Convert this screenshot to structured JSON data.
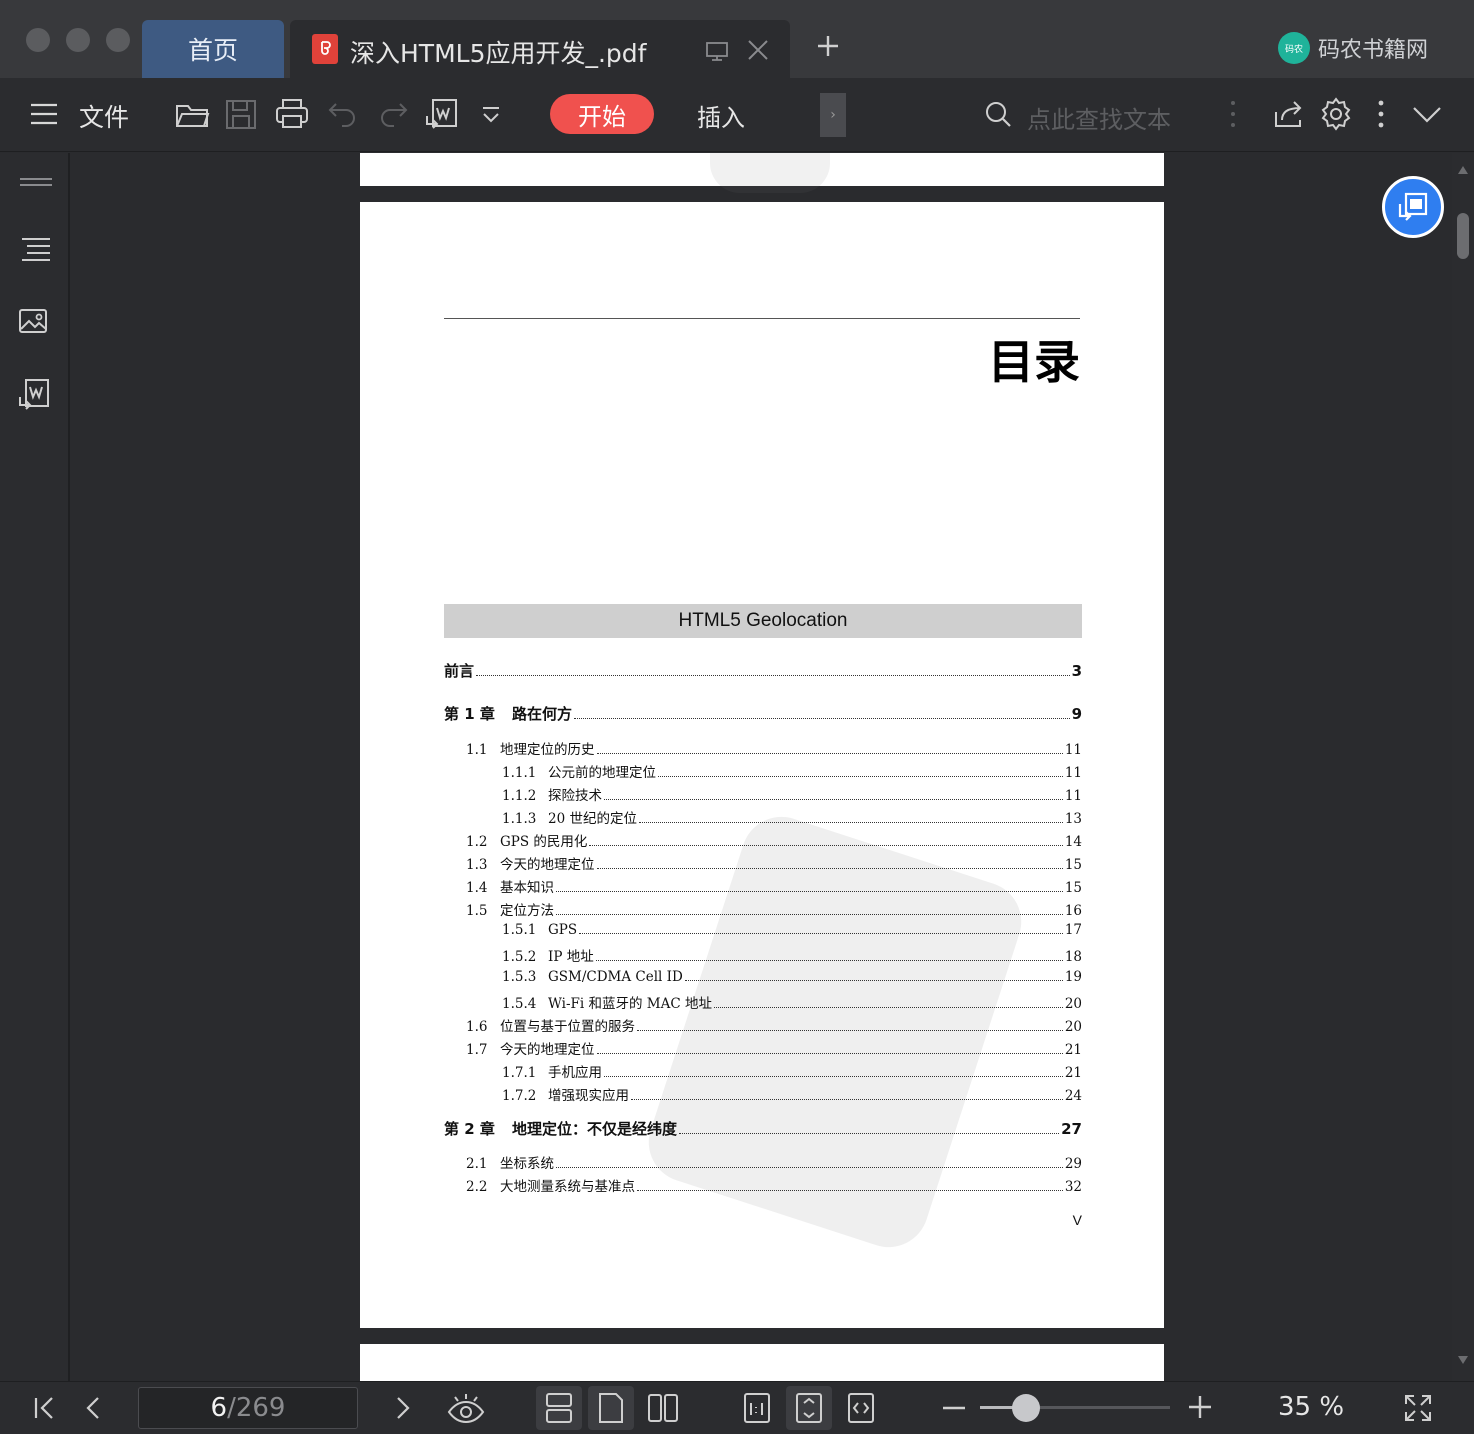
{
  "tabs": {
    "home_label": "首页",
    "doc_title": "深入HTML5应用开发_.pdf"
  },
  "brand": {
    "logo_text": "码农",
    "name": "码农书籍网"
  },
  "toolbar": {
    "file_label": "文件",
    "start_label": "开始",
    "insert_label": "插入",
    "search_placeholder": "点此查找文本"
  },
  "document": {
    "toc_title": "目录",
    "banner": "HTML5 Geolocation",
    "entries": [
      {
        "level": 0,
        "num": "",
        "text": "前言",
        "page": "3"
      },
      {
        "level": 0,
        "num": "第 1 章",
        "text": "路在何方",
        "page": "9"
      },
      {
        "level": 1,
        "num": "1.1",
        "text": "地理定位的历史",
        "page": "11"
      },
      {
        "level": 2,
        "num": "1.1.1",
        "text": "公元前的地理定位",
        "page": "11"
      },
      {
        "level": 2,
        "num": "1.1.2",
        "text": "探险技术",
        "page": "11"
      },
      {
        "level": 2,
        "num": "1.1.3",
        "text": "20 世纪的定位",
        "page": "13"
      },
      {
        "level": 1,
        "num": "1.2",
        "text": "GPS 的民用化",
        "page": "14"
      },
      {
        "level": 1,
        "num": "1.3",
        "text": "今天的地理定位",
        "page": "15"
      },
      {
        "level": 1,
        "num": "1.4",
        "text": "基本知识",
        "page": "15"
      },
      {
        "level": 1,
        "num": "1.5",
        "text": "定位方法",
        "page": "16"
      },
      {
        "level": 2,
        "num": "1.5.1",
        "text": "GPS",
        "page": "17"
      },
      {
        "level": 2,
        "num": "1.5.2",
        "text": "IP 地址",
        "page": "18"
      },
      {
        "level": 2,
        "num": "1.5.3",
        "text": "GSM/CDMA Cell ID",
        "page": "19"
      },
      {
        "level": 2,
        "num": "1.5.4",
        "text": "Wi-Fi 和蓝牙的 MAC 地址",
        "page": "20"
      },
      {
        "level": 1,
        "num": "1.6",
        "text": "位置与基于位置的服务",
        "page": "20"
      },
      {
        "level": 1,
        "num": "1.7",
        "text": "今天的地理定位",
        "page": "21"
      },
      {
        "level": 2,
        "num": "1.7.1",
        "text": "手机应用",
        "page": "21"
      },
      {
        "level": 2,
        "num": "1.7.2",
        "text": "增强现实应用",
        "page": "24"
      },
      {
        "level": 0,
        "num": "第 2 章",
        "text": "地理定位：不仅是经纬度",
        "page": "27"
      },
      {
        "level": 1,
        "num": "2.1",
        "text": "坐标系统",
        "page": "29"
      },
      {
        "level": 1,
        "num": "2.2",
        "text": "大地测量系统与基准点",
        "page": "32"
      }
    ],
    "page_roman": "V"
  },
  "navigation": {
    "current_page": "6",
    "separator": "/",
    "total_pages": "269"
  },
  "zoom": {
    "label": "35 %",
    "level": 0.35
  },
  "colors": {
    "accent_start": "#f0514e",
    "home_tab": "#3e5a82",
    "fab": "#2f7ef0",
    "pdf_badge": "#e0423a"
  },
  "icons": [
    "hamburger-icon",
    "open-folder-icon",
    "save-icon",
    "print-icon",
    "undo-icon",
    "redo-icon",
    "pdf-to-word-icon",
    "dropdown-icon",
    "search-icon",
    "share-icon",
    "settings-icon",
    "more-icon",
    "collapse-icon",
    "thumbnails-icon",
    "outline-icon",
    "image-icon",
    "convert-icon",
    "first-page-icon",
    "prev-page-icon",
    "next-page-icon",
    "eye-icon",
    "continuous-view-icon",
    "single-page-icon",
    "two-page-icon",
    "actual-size-icon",
    "fit-page-icon",
    "fit-width-icon",
    "zoom-out-icon",
    "zoom-in-icon",
    "fullscreen-icon"
  ]
}
